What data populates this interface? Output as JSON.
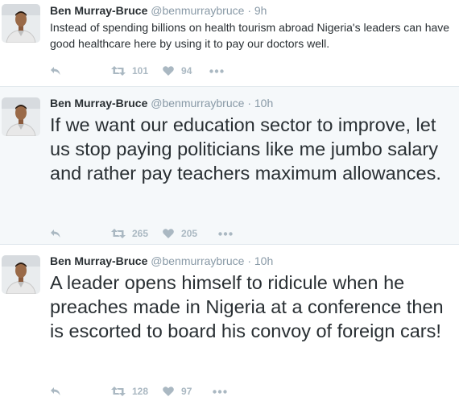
{
  "colors": {
    "name": "#292f33",
    "meta": "#8899a6",
    "action_icon": "#aab8c2",
    "highlight_bg": "#f5f8fa",
    "divider": "#e1e8ed"
  },
  "icons": {
    "reply": "reply-arrow-icon",
    "retweet": "retweet-icon",
    "like": "heart-icon",
    "more": "more-dots-icon"
  },
  "tweets": [
    {
      "name": "Ben Murray-Bruce",
      "handle": "@benmurraybruce",
      "separator": "·",
      "time": "9h",
      "text": "Instead of spending billions on health tourism abroad Nigeria's leaders can have good healthcare here by using it to pay our doctors well.",
      "retweets": "101",
      "likes": "94",
      "highlighted": false
    },
    {
      "name": "Ben Murray-Bruce",
      "handle": "@benmurraybruce",
      "separator": "·",
      "time": "10h",
      "text": "If we want our education sector to improve, let us stop paying politicians like me jumbo salary and rather pay teachers maximum allowances.",
      "retweets": "265",
      "likes": "205",
      "highlighted": true
    },
    {
      "name": "Ben Murray-Bruce",
      "handle": "@benmurraybruce",
      "separator": "·",
      "time": "10h",
      "text": "A leader opens himself to ridicule when he preaches made in Nigeria at a conference then is escorted to board his convoy of foreign cars!",
      "retweets": "128",
      "likes": "97",
      "highlighted": false
    }
  ]
}
